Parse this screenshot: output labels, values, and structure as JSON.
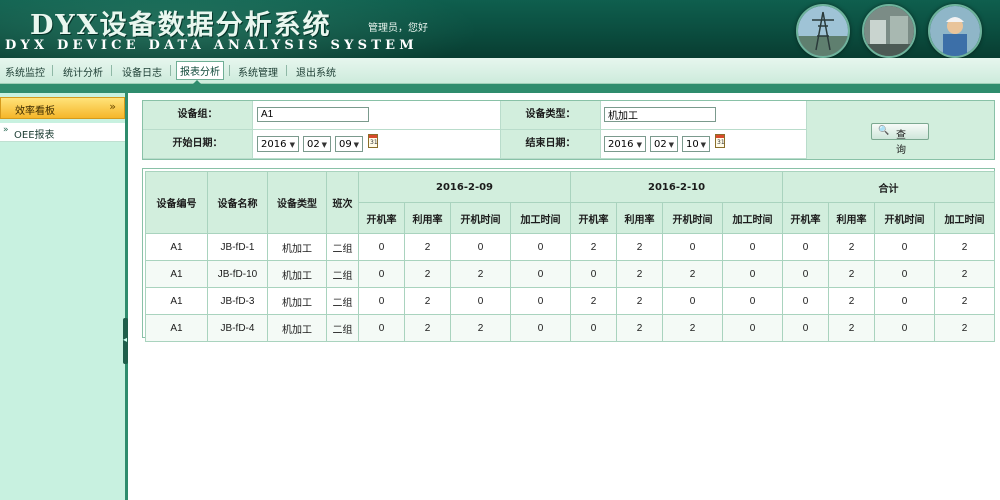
{
  "header": {
    "title_cn": "DYX设备数据分析系统",
    "title_en": "DYX DEVICE DATA ANALYSIS SYSTEM",
    "greeting": "管理员，您好"
  },
  "nav": {
    "items": [
      "系统监控",
      "统计分析",
      "设备日志",
      "报表分析",
      "系统管理",
      "退出系统"
    ],
    "active": "报表分析"
  },
  "sidebar": {
    "header": "效率看板",
    "items": [
      {
        "label": "OEE报表",
        "icon": "double-chevron-right-icon"
      }
    ]
  },
  "filters": {
    "group_label": "设备组：",
    "group_value": "A1",
    "type_label": "设备类型：",
    "type_value": "机加工",
    "start_label": "开始日期：",
    "start_year": "2016",
    "start_month": "02",
    "start_day": "09",
    "end_label": "结束日期：",
    "end_year": "2016",
    "end_month": "02",
    "end_day": "10",
    "query_label": "查 询"
  },
  "table": {
    "fixed_headers": [
      "设备编号",
      "设备名称",
      "设备类型",
      "班次"
    ],
    "groups": [
      "2016-2-09",
      "2016-2-10",
      "合计"
    ],
    "metrics": [
      "开机率",
      "利用率",
      "开机时间",
      "加工时间"
    ],
    "rows": [
      [
        "A1",
        "JB-fD-1",
        "机加工",
        "二组",
        "0",
        "2",
        "0",
        "0",
        "2",
        "2",
        "0",
        "0",
        "0",
        "2",
        "0",
        "2"
      ],
      [
        "A1",
        "JB-fD-10",
        "机加工",
        "二组",
        "0",
        "2",
        "2",
        "0",
        "0",
        "2",
        "2",
        "0",
        "0",
        "2",
        "0",
        "2"
      ],
      [
        "A1",
        "JB-fD-3",
        "机加工",
        "二组",
        "0",
        "2",
        "0",
        "0",
        "2",
        "2",
        "0",
        "0",
        "0",
        "2",
        "0",
        "2"
      ],
      [
        "A1",
        "JB-fD-4",
        "机加工",
        "二组",
        "0",
        "2",
        "2",
        "0",
        "0",
        "2",
        "2",
        "0",
        "0",
        "2",
        "0",
        "2"
      ]
    ]
  },
  "colors": {
    "header_bg": "#0b4d3f",
    "accent": "#2f8c6d",
    "sidebar_bg": "#c8f1e0",
    "sidebar_header": "#f5b62a",
    "table_header_bg": "#d2eedd"
  }
}
